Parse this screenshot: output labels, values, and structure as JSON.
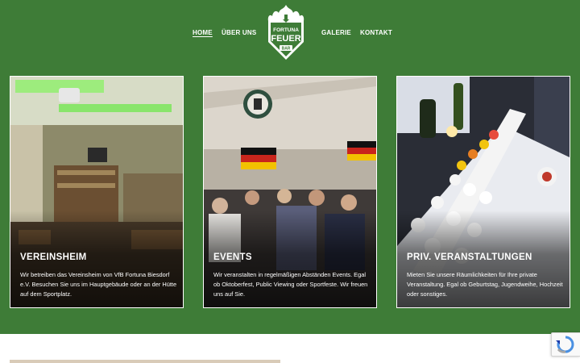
{
  "nav": {
    "home": "HOME",
    "ueber": "ÜBER UNS",
    "galerie": "GALERIE",
    "kontakt": "KONTAKT"
  },
  "logo": {
    "line1": "FORTUNA",
    "line2": "FEUER",
    "line3": "BAR"
  },
  "cards": [
    {
      "title": "VEREINSHEIM",
      "text": "Wir betreiben das Vereinsheim von VfB Fortuna Biesdorf e.V. Besuchen Sie uns im Hauptgebäude oder an der Hütte auf dem Sportplatz."
    },
    {
      "title": "EVENTS",
      "text": "Wir veranstalten in regelmäßigen Abständen Events. Egal ob Oktoberfest, Public Viewing oder Sportfeste. Wir freuen uns auf Sie."
    },
    {
      "title": "PRIV. VERANSTALTUNGEN",
      "text": "Mieten Sie unsere Räumlichkeiten für Ihre private Veranstaltung. Egal ob Geburtstag, Jugendweihe, Hochzeit oder sonstiges."
    }
  ],
  "colors": {
    "brand_green": "#3e7c37",
    "text_white": "#ffffff"
  }
}
